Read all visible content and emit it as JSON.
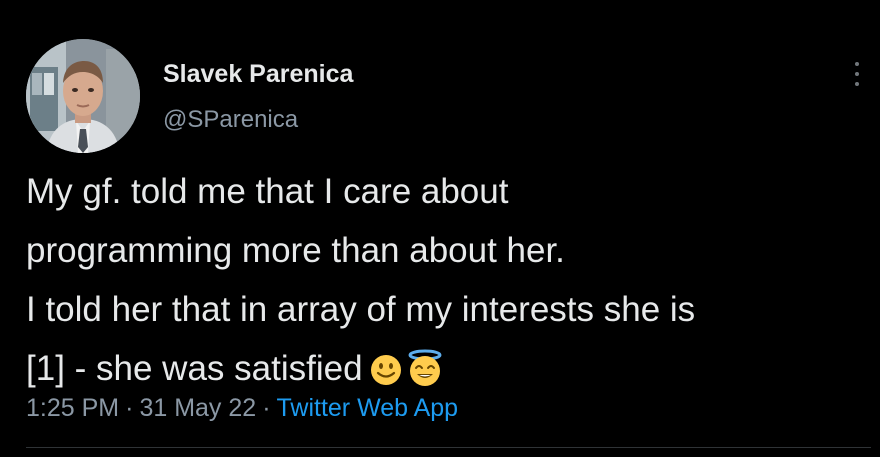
{
  "colors": {
    "background": "#000000",
    "primary_text": "#e7e9ea",
    "secondary_text": "#8b98a5",
    "link": "#1d9bf0"
  },
  "author": {
    "name": "Slavek Parenica",
    "handle": "@SParenica"
  },
  "tweet": {
    "lines": [
      "My gf. told me that I care about",
      "programming more than about her.",
      "I told her that in array of my interests she is",
      "[1] - she was satisfied"
    ],
    "emojis": [
      "slightly-smiling-face-icon",
      "smiling-face-with-halo-icon"
    ]
  },
  "meta": {
    "time": "1:25 PM",
    "separator": "·",
    "date": "31 May 22",
    "source": "Twitter Web App"
  }
}
